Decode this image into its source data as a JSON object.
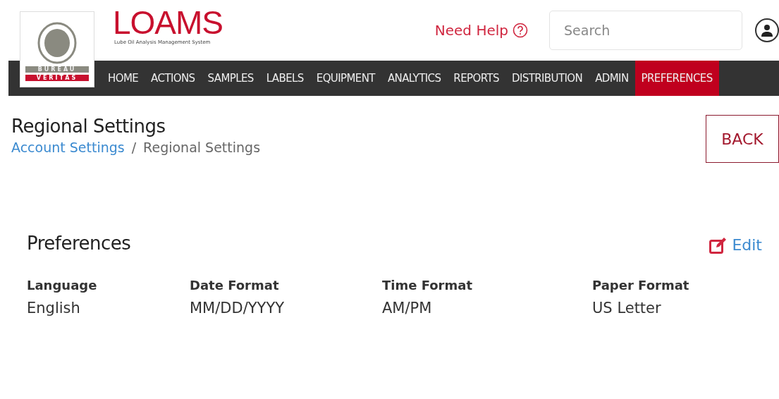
{
  "logo": {
    "name": "LOAMS",
    "tagline": "Lube Oil Analysis Management System"
  },
  "badge": {
    "top": "BUREAU",
    "bottom": "VERITAS"
  },
  "help": {
    "label": "Need Help"
  },
  "search": {
    "placeholder": "Search"
  },
  "nav": [
    {
      "label": "HOME",
      "selected": false
    },
    {
      "label": "ACTIONS",
      "selected": false
    },
    {
      "label": "SAMPLES",
      "selected": false
    },
    {
      "label": "LABELS",
      "selected": false
    },
    {
      "label": "EQUIPMENT",
      "selected": false
    },
    {
      "label": "ANALYTICS",
      "selected": false
    },
    {
      "label": "REPORTS",
      "selected": false
    },
    {
      "label": "DISTRIBUTION",
      "selected": false
    },
    {
      "label": "ADMIN",
      "selected": false
    },
    {
      "label": "PREFERENCES",
      "selected": true
    }
  ],
  "page": {
    "title": "Regional Settings",
    "breadcrumb": [
      "Account Settings",
      "Regional Settings"
    ],
    "separator": "/",
    "back": "BACK"
  },
  "section": {
    "title": "Preferences",
    "edit": "Edit",
    "fields": [
      {
        "label": "Language",
        "value": "English"
      },
      {
        "label": "Date Format",
        "value": "MM/DD/YYYY"
      },
      {
        "label": "Time Format",
        "value": "AM/PM"
      },
      {
        "label": "Paper Format",
        "value": "US Letter"
      }
    ]
  }
}
